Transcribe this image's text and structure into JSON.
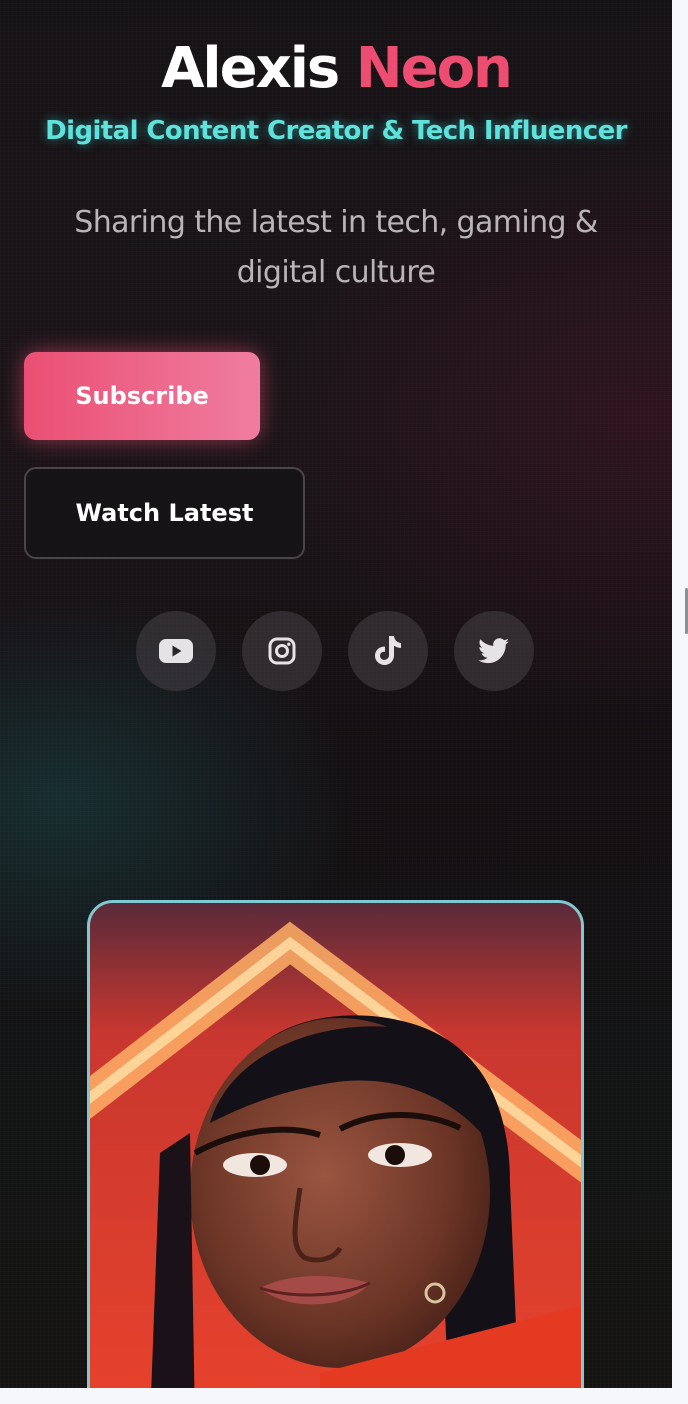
{
  "hero": {
    "name_first": "Alexis",
    "name_last": "Neon",
    "subtitle": "Digital Content Creator & Tech Influencer",
    "tagline_line1": "Sharing the latest in tech, gaming &",
    "tagline_line2": "digital culture"
  },
  "buttons": {
    "subscribe_label": "Subscribe",
    "watch_label": "Watch Latest"
  },
  "socials": [
    {
      "icon": "youtube-icon"
    },
    {
      "icon": "instagram-icon"
    },
    {
      "icon": "tiktok-icon"
    },
    {
      "icon": "twitter-icon"
    }
  ],
  "colors": {
    "accent_pink": "#ee4d72",
    "accent_cyan": "#5fe2dc",
    "background": "#151215",
    "frame_border": "#7ec9d2"
  }
}
